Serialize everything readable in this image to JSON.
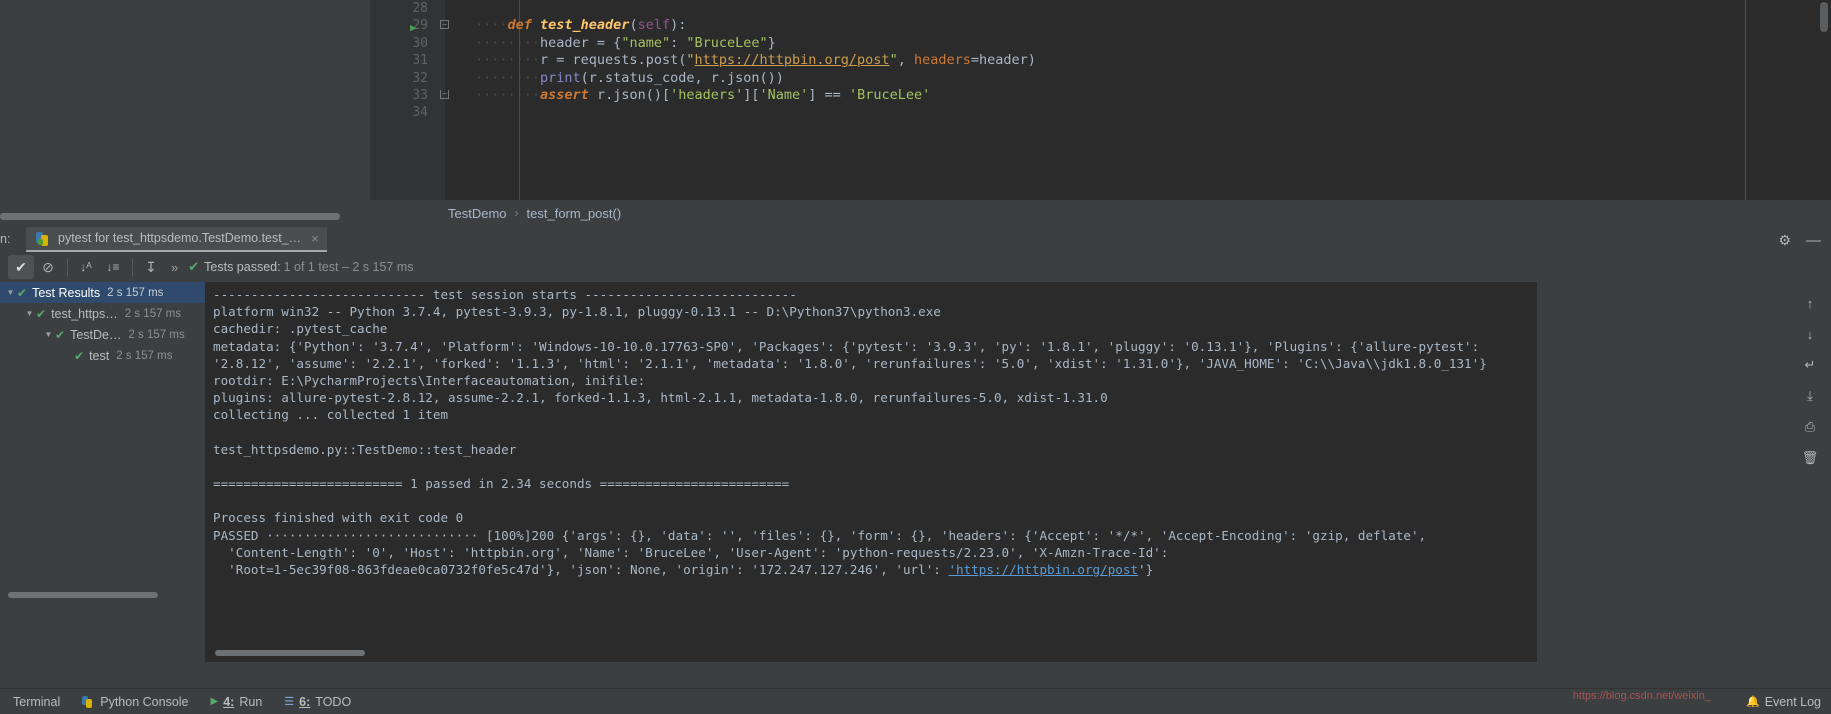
{
  "editor": {
    "breadcrumb": {
      "class_name": "TestDemo",
      "separator": "›",
      "method_name": "test_form_post()"
    },
    "lines": [
      {
        "num": "28",
        "segments": []
      },
      {
        "num": "29",
        "has_run_arrow": true,
        "has_fold": true,
        "segments": [
          {
            "t": "····",
            "c": "dots"
          },
          {
            "t": "def ",
            "c": "kw"
          },
          {
            "t": "test_header",
            "c": "fn"
          },
          {
            "t": "(",
            "c": "plain"
          },
          {
            "t": "self",
            "c": "self"
          },
          {
            "t": "):",
            "c": "plain"
          }
        ]
      },
      {
        "num": "30",
        "segments": [
          {
            "t": "········",
            "c": "dots"
          },
          {
            "t": "header = {",
            "c": "plain"
          },
          {
            "t": "\"name\"",
            "c": "strq"
          },
          {
            "t": ": ",
            "c": "plain"
          },
          {
            "t": "\"BruceLee\"",
            "c": "strq"
          },
          {
            "t": "}",
            "c": "plain"
          }
        ]
      },
      {
        "num": "31",
        "segments": [
          {
            "t": "········",
            "c": "dots"
          },
          {
            "t": "r = requests.post(",
            "c": "plain"
          },
          {
            "t": "\"",
            "c": "strq"
          },
          {
            "t": "https://httpbin.org/post",
            "c": "link"
          },
          {
            "t": "\"",
            "c": "strq"
          },
          {
            "t": ", ",
            "c": "plain"
          },
          {
            "t": "headers",
            "c": "prm"
          },
          {
            "t": "=header)",
            "c": "plain"
          }
        ]
      },
      {
        "num": "32",
        "segments": [
          {
            "t": "········",
            "c": "dots"
          },
          {
            "t": "print",
            "c": "bi"
          },
          {
            "t": "(r.status_code, r.json())",
            "c": "plain"
          }
        ]
      },
      {
        "num": "33",
        "has_fold_end": true,
        "segments": [
          {
            "t": "········",
            "c": "dots"
          },
          {
            "t": "assert ",
            "c": "kw"
          },
          {
            "t": "r.json()[",
            "c": "plain"
          },
          {
            "t": "'headers'",
            "c": "strq"
          },
          {
            "t": "][",
            "c": "plain"
          },
          {
            "t": "'Name'",
            "c": "strq"
          },
          {
            "t": "] == ",
            "c": "plain"
          },
          {
            "t": "'BruceLee'",
            "c": "strq"
          }
        ]
      },
      {
        "num": "34",
        "segments": []
      }
    ]
  },
  "run_panel": {
    "run_label": "n:",
    "tab": {
      "icon": "python-pytest-icon",
      "title": "pytest for test_httpsdemo.TestDemo.test_…",
      "close": "×"
    },
    "toolbar": {
      "buttons": [
        {
          "name": "show-passed-button",
          "glyph": "✔",
          "selected": true
        },
        {
          "name": "show-ignored-button",
          "glyph": "⊘",
          "selected": false
        },
        {
          "name": "sort-alphabetically-button",
          "glyph": "↓ᴀ",
          "selected": false
        },
        {
          "name": "sort-by-duration-button",
          "glyph": "↓≡",
          "selected": false
        },
        {
          "name": "expand-collapse-button",
          "glyph": "⤒",
          "selected": false
        }
      ],
      "chevrons": "»",
      "status_check": "✔",
      "status_main": "Tests passed:",
      "status_sub": "1 of 1 test – 2 s 157 ms"
    },
    "tree": [
      {
        "label": "Test Results",
        "time": "2 s 157 ms",
        "indent": 0,
        "expanded": true,
        "selected": true
      },
      {
        "label": "test_https…",
        "time": "2 s 157 ms",
        "indent": 1,
        "expanded": true,
        "selected": false
      },
      {
        "label": "TestDe…",
        "time": "2 s 157 ms",
        "indent": 2,
        "expanded": true,
        "selected": false
      },
      {
        "label": "test",
        "time": "2 s 157 ms",
        "indent": 3,
        "expanded": false,
        "selected": false
      }
    ],
    "console_lines": [
      "---------------------------- test session starts ----------------------------",
      "platform win32 -- Python 3.7.4, pytest-3.9.3, py-1.8.1, pluggy-0.13.1 -- D:\\Python37\\python3.exe",
      "cachedir: .pytest_cache",
      "metadata: {'Python': '3.7.4', 'Platform': 'Windows-10-10.0.17763-SP0', 'Packages': {'pytest': '3.9.3', 'py': '1.8.1', 'pluggy': '0.13.1'}, 'Plugins': {'allure-pytest':",
      "'2.8.12', 'assume': '2.2.1', 'forked': '1.1.3', 'html': '2.1.1', 'metadata': '1.8.0', 'rerunfailures': '5.0', 'xdist': '1.31.0'}, 'JAVA_HOME': 'C:\\\\Java\\\\jdk1.8.0_131'}",
      "rootdir: E:\\PycharmProjects\\Interfaceautomation, inifile:",
      "plugins: allure-pytest-2.8.12, assume-2.2.1, forked-1.1.3, html-2.1.1, metadata-1.8.0, rerunfailures-5.0, xdist-1.31.0",
      "collecting ... collected 1 item",
      "",
      "test_httpsdemo.py::TestDemo::test_header",
      "",
      "========================= 1 passed in 2.34 seconds =========================",
      "",
      "Process finished with exit code 0"
    ],
    "passed_output": {
      "label": "PASSED",
      "dots": "····························",
      "line1": "[100%]200 {'args': {}, 'data': '', 'files': {}, 'form': {}, 'headers': {'Accept': '*/*', 'Accept-Encoding': 'gzip, deflate',",
      "line2": "'Content-Length': '0', 'Host': 'httpbin.org', 'Name': 'BruceLee', 'User-Agent': 'python-requests/2.23.0', 'X-Amzn-Trace-Id':",
      "line3_pre": "'Root=1-5ec39f08-863fdeae0ca0732f0fe5c47d'}, 'json': None, 'origin': '172.247.127.246', 'url': ",
      "line3_link": "https://httpbin.org/post",
      "line3_post": "'}"
    },
    "right_tools": [
      {
        "name": "scroll-up-button",
        "glyph": "↑"
      },
      {
        "name": "scroll-down-button",
        "glyph": "↓"
      },
      {
        "name": "soft-wrap-button",
        "glyph": "↵"
      },
      {
        "name": "export-button",
        "glyph": "⤓"
      },
      {
        "name": "print-button",
        "glyph": "⎙"
      },
      {
        "name": "clear-all-button",
        "glyph": "🗑"
      }
    ],
    "gear": "⚙",
    "minimize": "—"
  },
  "status_bar": {
    "items": [
      {
        "name": "terminal",
        "label": "Terminal",
        "icon": ""
      },
      {
        "name": "python-console",
        "label": "Python Console",
        "icon": "python-icon"
      },
      {
        "name": "run",
        "num": "4:",
        "label": "Run",
        "icon": "run-icon"
      },
      {
        "name": "todo",
        "num": "6:",
        "label": "TODO",
        "icon": "todo-icon"
      }
    ],
    "event_log": "Event Log",
    "watermark": "https://blog.csdn.net/weixin_"
  }
}
